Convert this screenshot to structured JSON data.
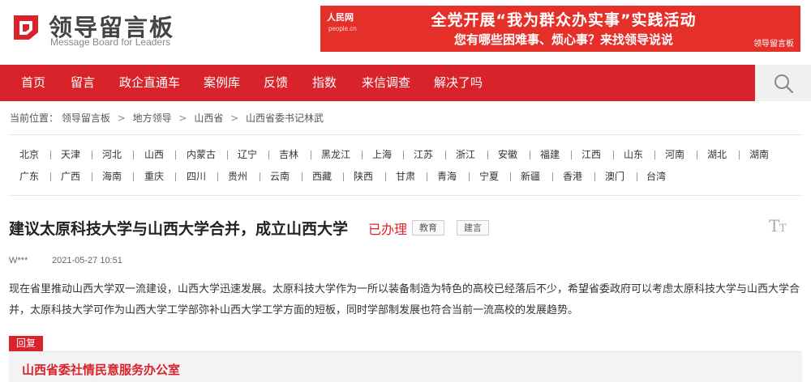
{
  "header": {
    "logo_cn": "领导留言板",
    "logo_en": "Message Board for Leaders",
    "banner": {
      "badge": "人民网",
      "badge_sub": "people.cn",
      "line1": "全党开展“我为群众办实事”实践活动",
      "line2": "您有哪些困难事、烦心事？来找领导说说",
      "brand": "领导留言板"
    }
  },
  "nav": {
    "items": [
      "首页",
      "留言",
      "政企直通车",
      "案例库",
      "反馈",
      "指数",
      "来信调查",
      "解决了吗"
    ]
  },
  "breadcrumb": {
    "prefix": "当前位置：",
    "items": [
      "领导留言板",
      "地方领导",
      "山西省",
      "山西省委书记林武"
    ],
    "sep": ">"
  },
  "provinces": {
    "row1": [
      "北京",
      "天津",
      "河北",
      "山西",
      "内蒙古",
      "辽宁",
      "吉林",
      "黑龙江",
      "上海",
      "江苏",
      "浙江",
      "安徽",
      "福建",
      "江西",
      "山东",
      "河南",
      "湖北",
      "湖南"
    ],
    "row2": [
      "广东",
      "广西",
      "海南",
      "重庆",
      "四川",
      "贵州",
      "云南",
      "西藏",
      "陕西",
      "甘肃",
      "青海",
      "宁夏",
      "新疆",
      "香港",
      "澳门",
      "台湾"
    ]
  },
  "message": {
    "title": "建议太原科技大学与山西大学合并，成立山西大学",
    "status": "已办理",
    "tags": [
      "教育",
      "建言"
    ],
    "author": "W***",
    "date": "2021-05-27 10:51",
    "content": "现在省里推动山西大学双一流建设，山西大学迅速发展。太原科技大学作为一所以装备制造为特色的高校已经落后不少，希望省委政府可以考虑太原科技大学与山西大学合并，太原科技大学可作为山西大学工学部弥补山西大学工学方面的短板，同时学部制发展也符合当前一流高校的发展趋势。"
  },
  "reply": {
    "label": "回复",
    "office": "山西省委社情民意服务办公室"
  },
  "colors": {
    "brand_red": "#d8232a",
    "banner_red": "#e5302a",
    "search_bg": "#f0f0f0",
    "reply_bg": "#f3f3f6"
  },
  "icons": {
    "search": "search-icon",
    "font_size": "font-size-icon",
    "logo": "logo-mark-icon"
  }
}
